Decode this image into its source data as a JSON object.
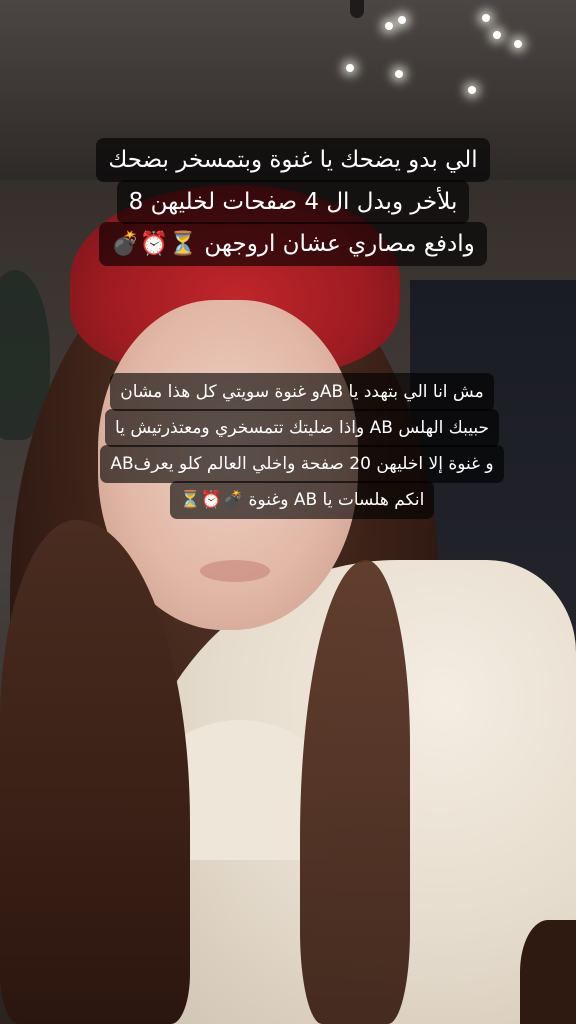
{
  "caption_top": {
    "lines": [
      "الي بدو يضحك يا غنوة وبتمسخر  بضحك",
      "بلأخر  وبدل ال 4 صفحات لخليهن 8",
      "وادفع مصاري عشان اروجهن  ⏳⏰💣"
    ]
  },
  "caption_bottom": {
    "lines": [
      "مش انا الي بتهدد يا ABو غنوة  سويتي كل هذا مشان",
      "حبيبك الهلس AB واذا ضليتك تتمسخري ومعتذرتيش يا",
      "ABو غنوة إلا اخليهن 20 صفحة واخلي العالم كلو يعرف",
      "انكم هلسات  يا  AB وغنوة 💣⏰⏳"
    ]
  }
}
